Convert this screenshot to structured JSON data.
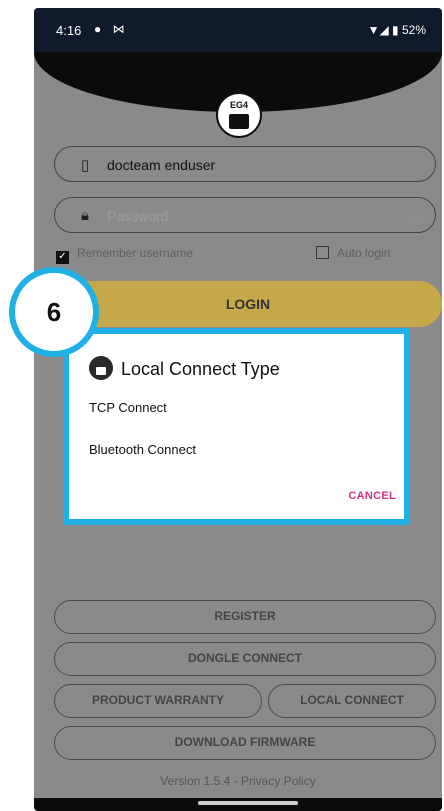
{
  "status_bar": {
    "time": "4:16",
    "left_icons": "● ⋈",
    "right": "▼◢ ▮ 52%"
  },
  "login": {
    "username": "docteam enduser",
    "password_placeholder": "Password",
    "remember_label": "Remember username",
    "remember_checked": true,
    "auto_login_label": "Auto login",
    "auto_login_checked": false,
    "login_button": "LOGIN"
  },
  "logo": {
    "text": "EG4"
  },
  "dialog": {
    "title": "Local Connect Type",
    "options": [
      "TCP Connect",
      "Bluetooth Connect"
    ],
    "cancel": "CANCEL"
  },
  "annotation": {
    "step": "6",
    "accent_color": "#1fb0e8"
  },
  "buttons": {
    "register": "REGISTER",
    "dongle_connect": "DONGLE CONNECT",
    "product_warranty": "PRODUCT WARRANTY",
    "local_connect": "LOCAL CONNECT",
    "download_firmware": "DOWNLOAD FIRMWARE"
  },
  "footer": {
    "version": "Version 1.5.4 - Privacy Policy"
  },
  "colors": {
    "login_button": "#c4a84a",
    "cancel": "#d63384",
    "overlay": "#8a8a8a"
  }
}
